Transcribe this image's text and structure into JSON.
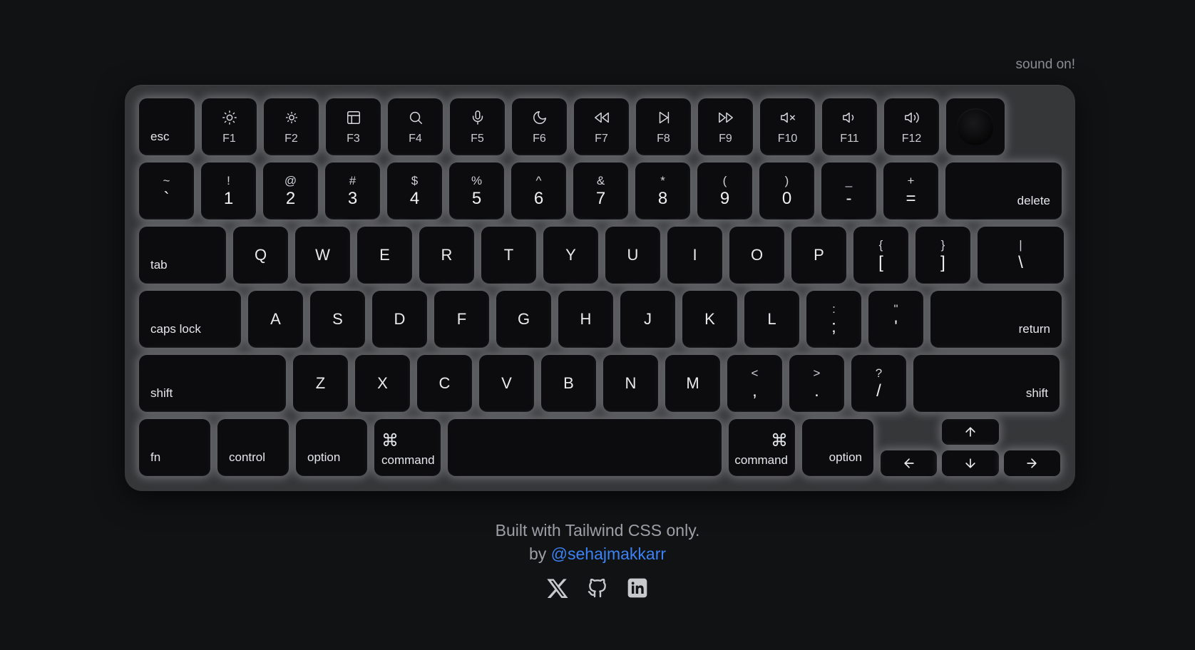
{
  "sound_toggle": "sound on!",
  "function_row": {
    "esc": "esc",
    "f_keys": [
      {
        "label": "F1",
        "icon": "brightness-low-icon"
      },
      {
        "label": "F2",
        "icon": "brightness-high-icon"
      },
      {
        "label": "F3",
        "icon": "mission-control-icon"
      },
      {
        "label": "F4",
        "icon": "search-icon"
      },
      {
        "label": "F5",
        "icon": "microphone-icon"
      },
      {
        "label": "F6",
        "icon": "moon-icon"
      },
      {
        "label": "F7",
        "icon": "rewind-icon"
      },
      {
        "label": "F8",
        "icon": "play-pause-icon"
      },
      {
        "label": "F9",
        "icon": "fast-forward-icon"
      },
      {
        "label": "F10",
        "icon": "mute-icon"
      },
      {
        "label": "F11",
        "icon": "volume-down-icon"
      },
      {
        "label": "F12",
        "icon": "volume-up-icon"
      }
    ]
  },
  "number_row": {
    "keys": [
      {
        "top": "~",
        "bottom": "`"
      },
      {
        "top": "!",
        "bottom": "1"
      },
      {
        "top": "@",
        "bottom": "2"
      },
      {
        "top": "#",
        "bottom": "3"
      },
      {
        "top": "$",
        "bottom": "4"
      },
      {
        "top": "%",
        "bottom": "5"
      },
      {
        "top": "^",
        "bottom": "6"
      },
      {
        "top": "&",
        "bottom": "7"
      },
      {
        "top": "*",
        "bottom": "8"
      },
      {
        "top": "(",
        "bottom": "9"
      },
      {
        "top": ")",
        "bottom": "0"
      },
      {
        "top": "_",
        "bottom": "-"
      },
      {
        "top": "+",
        "bottom": "="
      }
    ],
    "delete": "delete"
  },
  "qwerty_row": {
    "tab": "tab",
    "letters": [
      "Q",
      "W",
      "E",
      "R",
      "T",
      "Y",
      "U",
      "I",
      "O",
      "P"
    ],
    "symbols": [
      {
        "top": "{",
        "bottom": "["
      },
      {
        "top": "}",
        "bottom": "]"
      },
      {
        "top": "|",
        "bottom": "\\"
      }
    ]
  },
  "home_row": {
    "caps": "caps lock",
    "letters": [
      "A",
      "S",
      "D",
      "F",
      "G",
      "H",
      "J",
      "K",
      "L"
    ],
    "symbols": [
      {
        "top": ":",
        "bottom": ";"
      },
      {
        "top": "\"",
        "bottom": "'"
      }
    ],
    "return": "return"
  },
  "shift_row": {
    "left_shift": "shift",
    "letters": [
      "Z",
      "X",
      "C",
      "V",
      "B",
      "N",
      "M"
    ],
    "symbols": [
      {
        "top": "<",
        "bottom": ","
      },
      {
        "top": ">",
        "bottom": "."
      },
      {
        "top": "?",
        "bottom": "/"
      }
    ],
    "right_shift": "shift"
  },
  "bottom_row": {
    "fn": "fn",
    "control": "control",
    "option_left": "option",
    "command_symbol": "⌘",
    "command_left": "command",
    "command_right": "command",
    "option_right": "option"
  },
  "footer": {
    "built_with": "Built with Tailwind CSS only.",
    "by": "by",
    "author": "@sehajmakkarr",
    "socials": [
      "x-icon",
      "github-icon",
      "linkedin-icon"
    ]
  },
  "colors": {
    "background": "#111214",
    "keyboard_body": "#363739",
    "key": "#0c0c0e",
    "link": "#3b82f6"
  }
}
